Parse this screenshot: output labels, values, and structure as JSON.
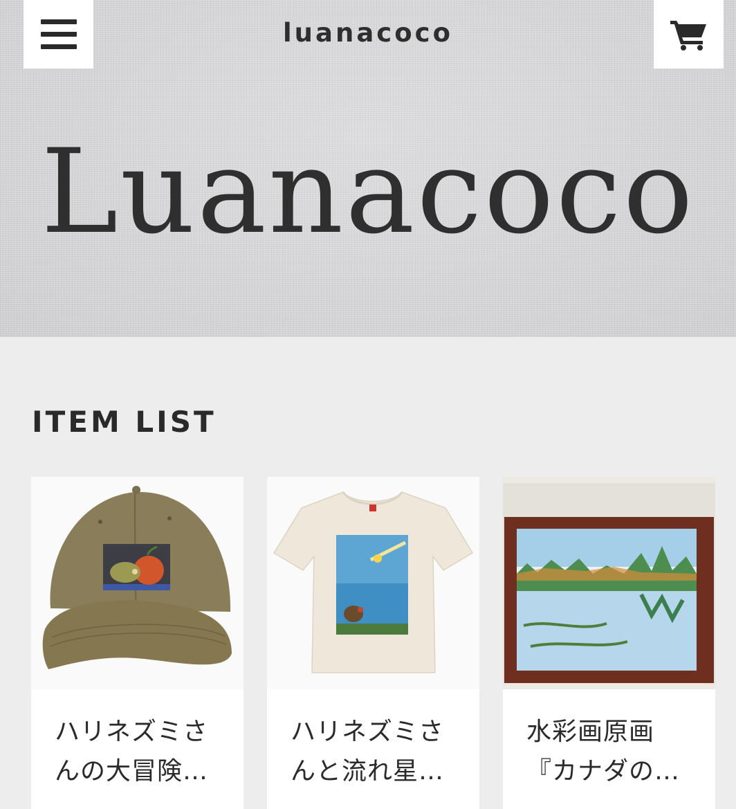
{
  "header": {
    "site_name": "luanacoco",
    "logo_text": "Luanacoco",
    "menu_icon": "hamburger-menu-icon",
    "cart_icon": "shopping-cart-icon"
  },
  "main": {
    "section_title": "ITEM LIST",
    "items": [
      {
        "title_line1": "ハリネズミさ",
        "title_line2": "んの大冒険…",
        "image": "khaki-cap-with-hedgehog-and-apple-print"
      },
      {
        "title_line1": "ハリネズミさ",
        "title_line2": "んと流れ星…",
        "image": "cream-t-shirt-with-hedgehog-and-shooting-star-print"
      },
      {
        "title_line1": "水彩画原画",
        "title_line2": "『カナダの…",
        "image": "framed-watercolor-canadian-lake-landscape"
      }
    ]
  },
  "colors": {
    "page_background": "#ededed",
    "hero_background": "#d6d6d8",
    "text": "#2a2a2a",
    "card_background": "#ffffff"
  }
}
